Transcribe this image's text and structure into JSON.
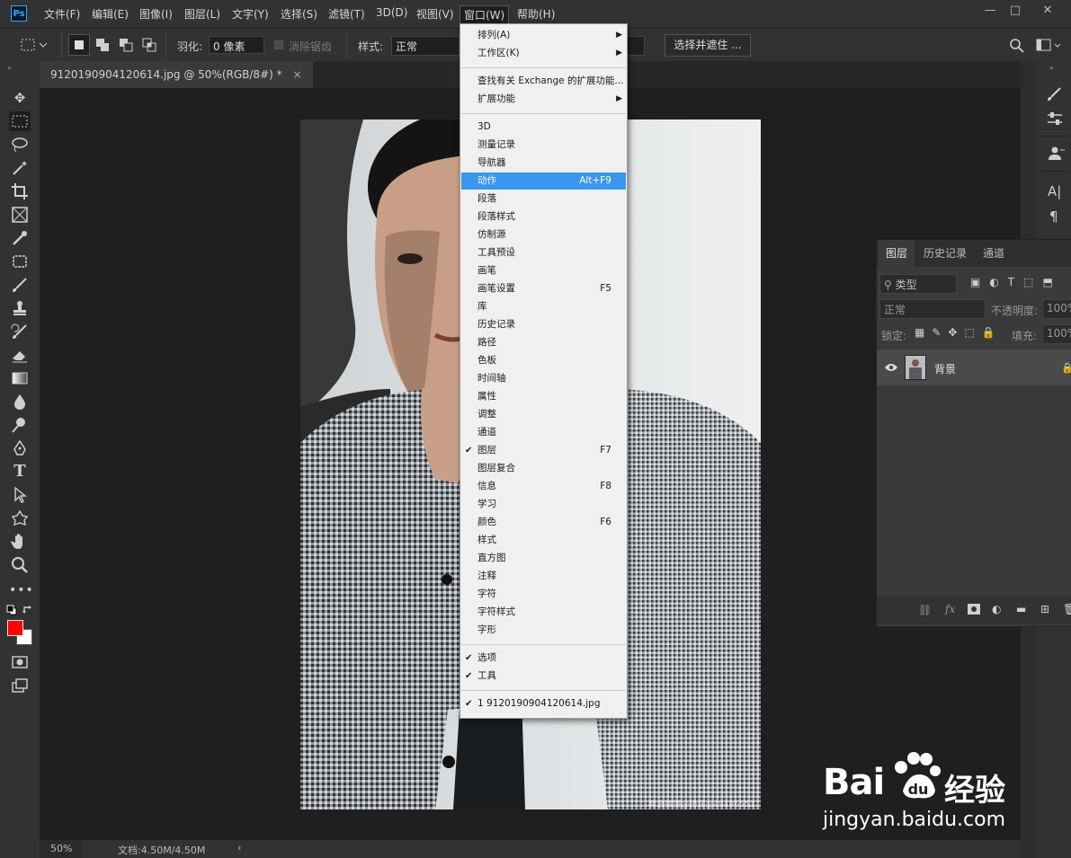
{
  "app": {
    "logo_text": "Ps"
  },
  "menubar": {
    "items": [
      "文件(F)",
      "编辑(E)",
      "图像(I)",
      "图层(L)",
      "文字(Y)",
      "选择(S)",
      "滤镜(T)",
      "3D(D)",
      "视图(V)",
      "窗口(W)",
      "帮助(H)"
    ],
    "active": "窗口(W)",
    "window_controls": [
      "—",
      "□",
      "✕"
    ]
  },
  "options": {
    "feather_label": "羽化:",
    "feather_value": "0 像素",
    "antialias_label": "消除锯齿",
    "style_label": "样式:",
    "style_value": "正常",
    "select_mask_button": "选择并遮住 ..."
  },
  "document": {
    "tab_title": "9120190904120614.jpg @ 50%(RGB/8#) *",
    "close_glyph": "×"
  },
  "statusbar": {
    "zoom": "50%",
    "doc_info": "文档:4.50M/4.50M",
    "arrow": "›"
  },
  "window_menu": {
    "items": [
      {
        "label": "排列(A)",
        "submenu": true
      },
      {
        "label": "工作区(K)",
        "submenu": true
      },
      {
        "label": "查找有关 Exchange 的扩展功能..."
      },
      {
        "label": "扩展功能",
        "submenu": true
      },
      {
        "label": "3D"
      },
      {
        "label": "测量记录"
      },
      {
        "label": "导航器"
      },
      {
        "label": "动作",
        "shortcut": "Alt+F9",
        "highlighted": true
      },
      {
        "label": "段落"
      },
      {
        "label": "段落样式"
      },
      {
        "label": "仿制源"
      },
      {
        "label": "工具预设"
      },
      {
        "label": "画笔"
      },
      {
        "label": "画笔设置",
        "shortcut": "F5"
      },
      {
        "label": "库"
      },
      {
        "label": "历史记录"
      },
      {
        "label": "路径"
      },
      {
        "label": "色板"
      },
      {
        "label": "时间轴"
      },
      {
        "label": "属性"
      },
      {
        "label": "调整"
      },
      {
        "label": "通道"
      },
      {
        "label": "图层",
        "shortcut": "F7",
        "checked": true
      },
      {
        "label": "图层复合"
      },
      {
        "label": "信息",
        "shortcut": "F8"
      },
      {
        "label": "学习"
      },
      {
        "label": "颜色",
        "shortcut": "F6"
      },
      {
        "label": "样式"
      },
      {
        "label": "直方图"
      },
      {
        "label": "注释"
      },
      {
        "label": "字符"
      },
      {
        "label": "字符样式"
      },
      {
        "label": "字形"
      },
      {
        "label": "选项",
        "checked": true
      },
      {
        "label": "工具",
        "checked": true
      },
      {
        "label": "1 9120190904120614.jpg",
        "checked": true
      }
    ],
    "check_glyph": "✔",
    "arrow_glyph": "▶"
  },
  "layers_panel": {
    "tabs": [
      "图层",
      "历史记录",
      "通道"
    ],
    "filter_label": "类型",
    "blend_mode": "正常",
    "opacity_label": "不透明度:",
    "opacity_value": "100%",
    "lock_label": "锁定:",
    "fill_label": "填充:",
    "fill_value": "100%",
    "layer_name": "背景"
  },
  "rightcol": {
    "text_icon": "A|",
    "para_icon": "¶"
  },
  "watermark": {
    "brand": "Bai",
    "brand_suffix": "经验",
    "url": "jingyan.baidu.com",
    "corner_text": "新浪微博@杨洋@49496553"
  },
  "colors": {
    "foreground": "#ff0000",
    "background": "#ffffff",
    "highlight": "#3a96ee"
  }
}
